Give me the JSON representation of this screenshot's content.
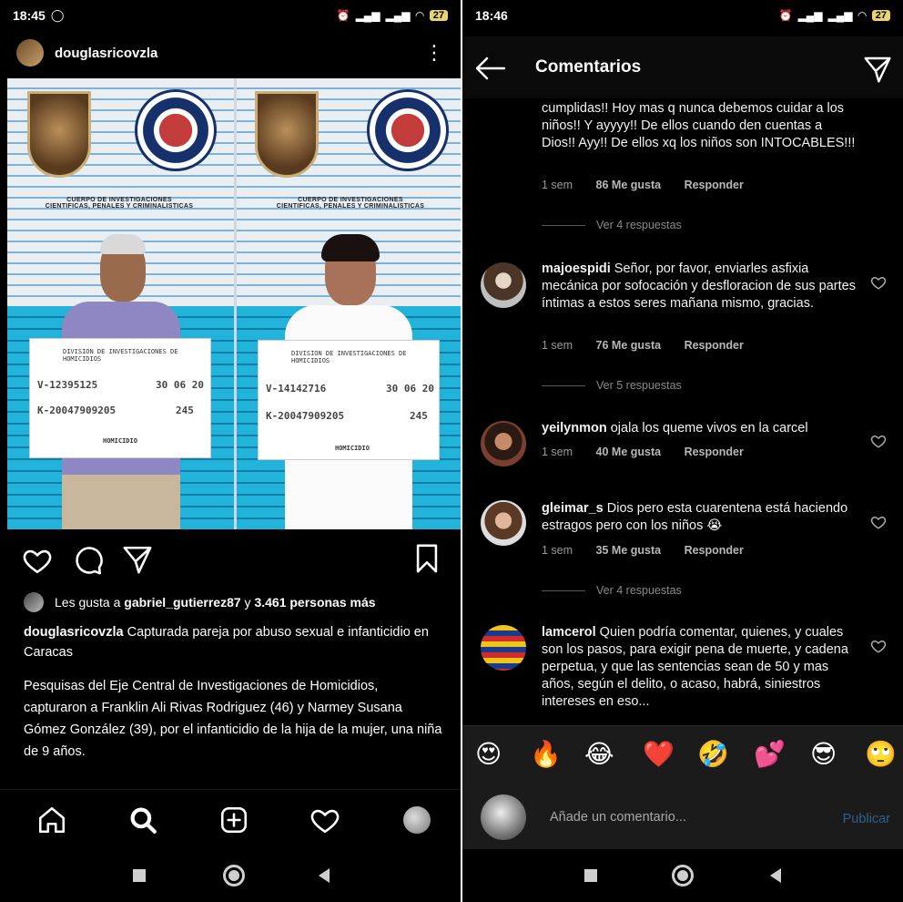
{
  "left": {
    "status": {
      "time": "18:45",
      "battery": "27"
    },
    "post": {
      "username": "douglasricovzla",
      "photo_text": {
        "institution": "CUERPO DE INVESTIGACIONES\nCIENTIFICAS, PENALES Y CRIMINALISTICAS",
        "division": "DIVISION DE INVESTIGACIONES DE HOMICIDIOS",
        "man": {
          "id": "V-12395125",
          "date": "30 06 20",
          "case": "K-20047909205",
          "num": "245",
          "label": "HOMICIDIO"
        },
        "woman": {
          "id": "V-14142716",
          "date": "30 06 20",
          "case": "K-20047909205",
          "num": "245",
          "label": "HOMICIDIO"
        }
      },
      "likes_prefix": "Les gusta a ",
      "likes_user": "gabriel_gutierrez87",
      "likes_mid": " y ",
      "likes_count": "3.461 personas más",
      "caption_user": "douglasricovzla",
      "caption_text": " Capturada pareja por abuso sexual e infanticidio en Caracas",
      "body": "Pesquisas del Eje Central de Investigaciones de Homicidios, capturaron a Franklin Ali Rivas Rodriguez (46) y Narmey Susana Gómez González (39), por el infanticidio de la hija de la mujer, una niña de 9 años."
    },
    "icons": {
      "like": "heart-icon",
      "comment": "comment-icon",
      "share": "send-icon",
      "save": "bookmark-icon"
    },
    "nav": [
      "home-icon",
      "search-icon",
      "add-icon",
      "heart-icon",
      "profile-avatar"
    ]
  },
  "right": {
    "status": {
      "time": "18:46",
      "battery": "27"
    },
    "title": "Comentarios",
    "comments": [
      {
        "user": "",
        "text": "cumplidas!! Hoy mas q nunca debemos cuidar a los niños!! Y ayyyy!! De ellos cuando den cuentas a Dios!! Ayy!! De ellos xq los niños son INTOCABLES!!!",
        "time": "1 sem",
        "likes": "86 Me gusta",
        "reply": "Responder",
        "view_replies": "Ver 4 respuestas"
      },
      {
        "user": "majoespidi",
        "text": " Señor, por favor, enviarles asfixia mecánica por sofocación y desfloracion de sus partes íntimas a estos seres mañana mismo, gracias.",
        "time": "1 sem",
        "likes": "76 Me gusta",
        "reply": "Responder",
        "view_replies": "Ver 5 respuestas"
      },
      {
        "user": "yeilynmon",
        "text": " ojala los queme vivos en la carcel",
        "time": "1 sem",
        "likes": "40 Me gusta",
        "reply": "Responder"
      },
      {
        "user": "gleimar_s",
        "text": " Dios pero esta cuarentena está haciendo estragos pero con los niños 😭",
        "time": "1 sem",
        "likes": "35 Me gusta",
        "reply": "Responder",
        "view_replies": "Ver 4 respuestas"
      },
      {
        "user": "lamcerol",
        "text": " Quien podría comentar, quienes, y cuales son los pasos, para exigir pena de muerte, y cadena perpetua, y que las sentencias sean de 50 y mas años, según el delito, o acaso, habrá, siniestros intereses en eso..."
      }
    ],
    "emojis": [
      "😍",
      "🔥",
      "😂",
      "❤️",
      "🤣",
      "💕",
      "😎",
      "🙄"
    ],
    "comment_placeholder": "Añade un comentario...",
    "publish": "Publicar"
  }
}
